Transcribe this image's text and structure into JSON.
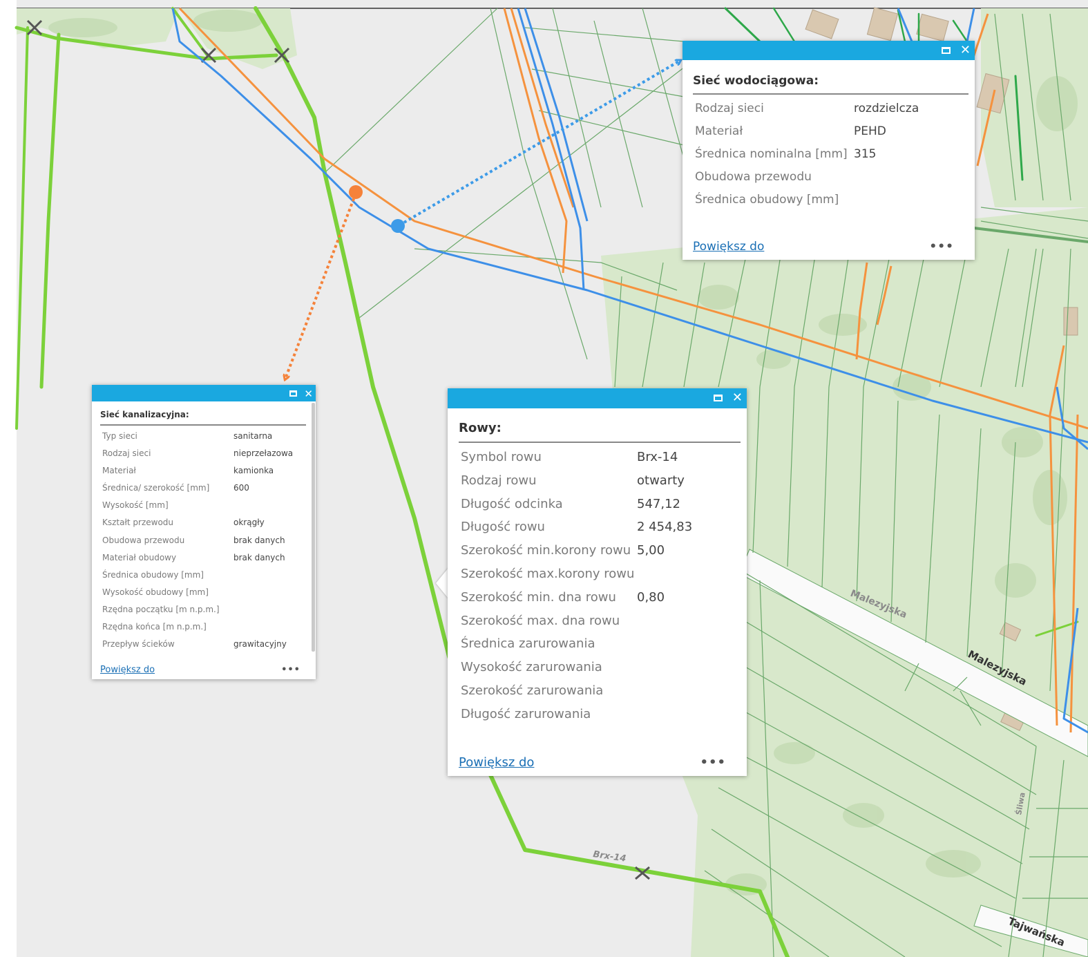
{
  "map": {
    "road_labels": [
      "Malezyjska",
      "Malezyjska",
      "Tajwańska",
      "Brx-14",
      "Śliwa"
    ]
  },
  "colors": {
    "water_pipe": "#3d8fe8",
    "sewer_pipe": "#f5923e",
    "ditch": "#7cd13a",
    "parcel_line": "#6aa86a",
    "popup_header": "#1aa8e0",
    "forest": "#d6e6c8",
    "background": "#ececec"
  },
  "popups": {
    "water": {
      "title": "Sieć wodociągowa:",
      "rows": [
        {
          "label": "Rodzaj sieci",
          "value": "rozdzielcza"
        },
        {
          "label": "Materiał",
          "value": "PEHD"
        },
        {
          "label": "Średnica nominalna [mm]",
          "value": "315"
        },
        {
          "label": "Obudowa przewodu",
          "value": ""
        },
        {
          "label": "Średnica obudowy [mm]",
          "value": ""
        }
      ],
      "zoom_label": "Powiększ do",
      "more_label": "•••",
      "maximize_icon": "maximize-icon",
      "close_label": "✕"
    },
    "sewer": {
      "title": "Sieć kanalizacyjna:",
      "rows": [
        {
          "label": "Typ sieci",
          "value": "sanitarna"
        },
        {
          "label": "Rodzaj sieci",
          "value": "nieprzełazowa"
        },
        {
          "label": "Materiał",
          "value": "kamionka"
        },
        {
          "label": "Średnica/ szerokość [mm]",
          "value": "600"
        },
        {
          "label": "Wysokość [mm]",
          "value": ""
        },
        {
          "label": "Kształt przewodu",
          "value": "okrągły"
        },
        {
          "label": "Obudowa przewodu",
          "value": "brak danych"
        },
        {
          "label": "Materiał obudowy",
          "value": "brak danych"
        },
        {
          "label": "Średnica obudowy [mm]",
          "value": ""
        },
        {
          "label": "Wysokość obudowy [mm]",
          "value": ""
        },
        {
          "label": "Rzędna początku [m n.p.m.]",
          "value": ""
        },
        {
          "label": "Rzędna końca [m n.p.m.]",
          "value": ""
        },
        {
          "label": "Przepływ ścieków",
          "value": "grawitacyjny"
        }
      ],
      "zoom_label": "Powiększ do",
      "more_label": "•••",
      "close_label": "✕"
    },
    "ditch": {
      "title": "Rowy:",
      "rows": [
        {
          "label": "Symbol rowu",
          "value": "Brx-14"
        },
        {
          "label": "Rodzaj rowu",
          "value": "otwarty"
        },
        {
          "label": "Długość odcinka",
          "value": "547,12"
        },
        {
          "label": "Długość rowu",
          "value": "2 454,83"
        },
        {
          "label": "Szerokość min.korony rowu",
          "value": "5,00"
        },
        {
          "label": "Szerokość max.korony rowu",
          "value": ""
        },
        {
          "label": "Szerokość min. dna rowu",
          "value": "0,80"
        },
        {
          "label": "Szerokość max. dna rowu",
          "value": ""
        },
        {
          "label": "Średnica zarurowania",
          "value": ""
        },
        {
          "label": "Wysokość zarurowania",
          "value": ""
        },
        {
          "label": "Szerokość zarurowania",
          "value": ""
        },
        {
          "label": "Długość zarurowania",
          "value": ""
        }
      ],
      "zoom_label": "Powiększ do",
      "more_label": "•••",
      "close_label": "✕"
    }
  }
}
